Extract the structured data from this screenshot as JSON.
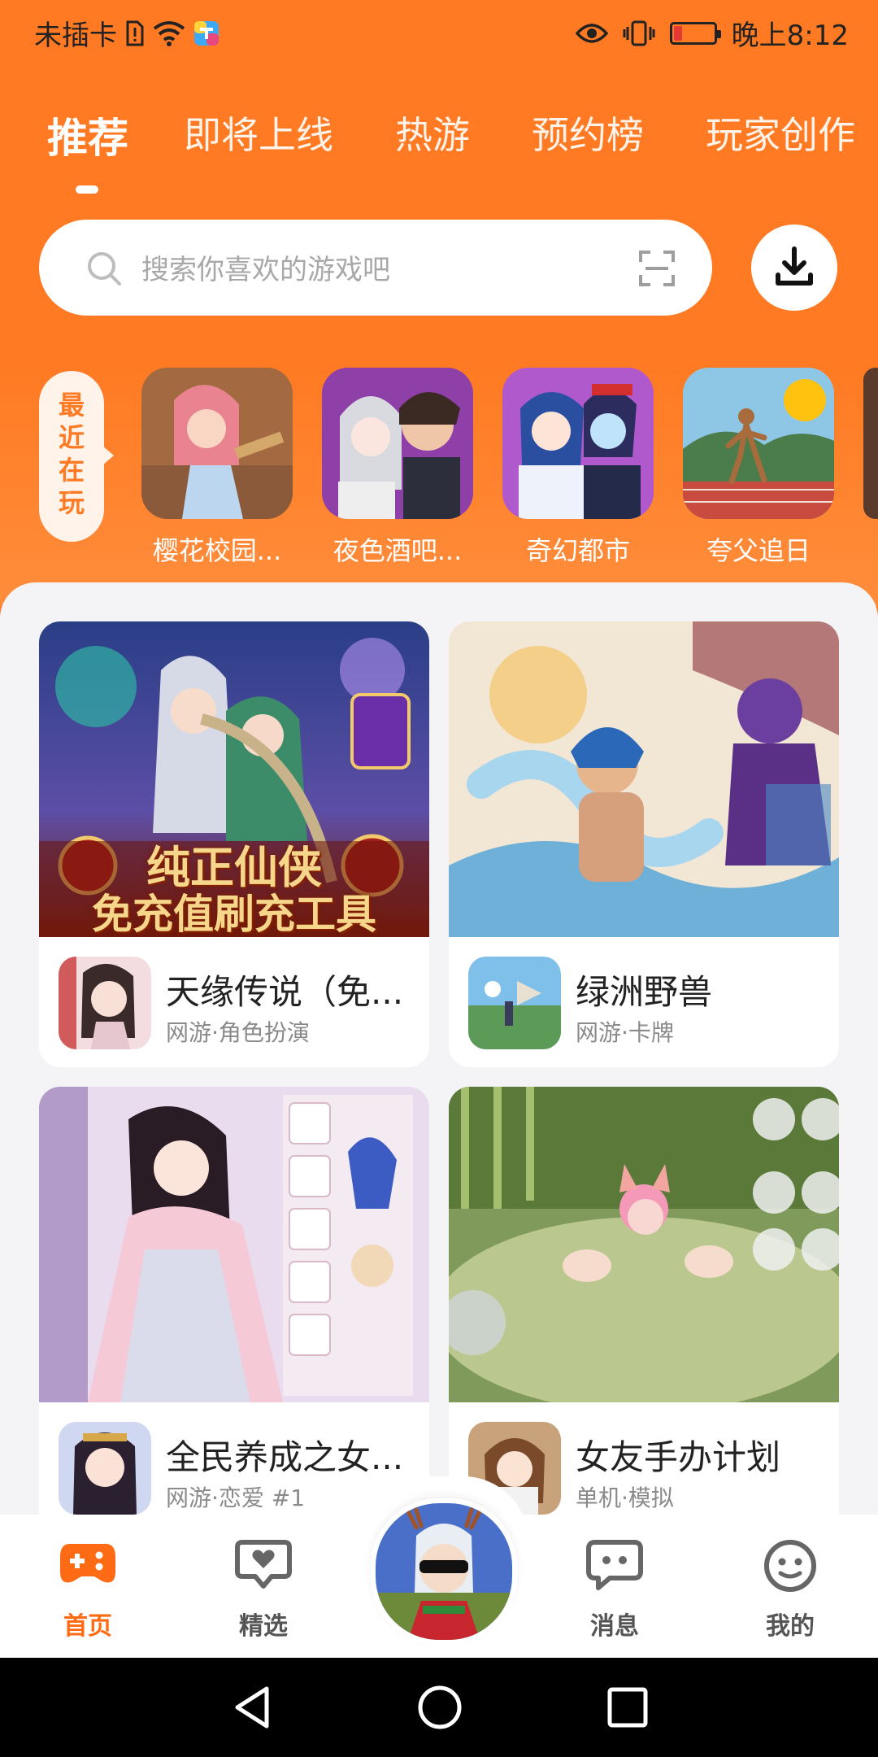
{
  "status_bar": {
    "carrier": "未插卡",
    "time": "晚上8:12"
  },
  "tabs": [
    {
      "label": "推荐",
      "active": true
    },
    {
      "label": "即将上线",
      "active": false
    },
    {
      "label": "热游",
      "active": false
    },
    {
      "label": "预约榜",
      "active": false
    },
    {
      "label": "玩家创作",
      "active": false
    }
  ],
  "search": {
    "placeholder": "搜索你喜欢的游戏吧"
  },
  "recent": {
    "label": "最近在玩",
    "games": [
      {
        "name": "樱花校园..."
      },
      {
        "name": "夜色酒吧..."
      },
      {
        "name": "奇幻都市"
      },
      {
        "name": "夸父追日"
      }
    ]
  },
  "cards": [
    {
      "title": "天缘传说（免...",
      "tags": "网游·角色扮演",
      "banner_text_1": "纯正仙侠",
      "banner_text_2": "免充值刷充工具"
    },
    {
      "title": "绿洲野兽",
      "tags": "网游·卡牌"
    },
    {
      "title": "全民养成之女...",
      "tags": "网游·恋爱 #1"
    },
    {
      "title": "女友手办计划",
      "tags": "单机·模拟"
    }
  ],
  "bottom_nav": [
    {
      "label": "首页",
      "icon": "gamepad-icon",
      "active": true
    },
    {
      "label": "精选",
      "icon": "heart-chat-icon",
      "active": false
    },
    {
      "label": "消息",
      "icon": "message-icon",
      "active": false
    },
    {
      "label": "我的",
      "icon": "smiley-icon",
      "active": false
    }
  ],
  "colors": {
    "accent": "#ff7a22",
    "active_nav": "#ff6a14"
  }
}
